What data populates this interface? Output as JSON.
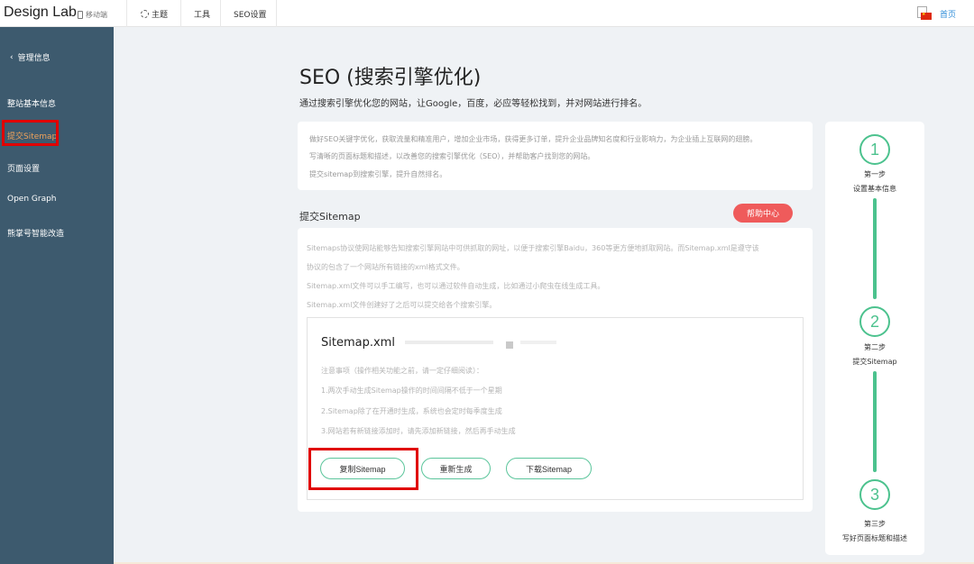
{
  "header": {
    "logo": "Design Lab",
    "mobile_label": "移动端",
    "nav": [
      {
        "label": "主题",
        "icon": "theme-icon"
      },
      {
        "label": "工具"
      },
      {
        "label": "SEO设置"
      }
    ],
    "home_label": "首页",
    "flag_icon": "cn-flag-icon"
  },
  "sidebar": {
    "back_label": "管理信息",
    "items": [
      {
        "label": "整站基本信息",
        "active": false
      },
      {
        "label": "提交Sitemap",
        "active": true
      },
      {
        "label": "页面设置",
        "active": false
      },
      {
        "label": "Open Graph",
        "active": false
      },
      {
        "label": "熊掌号智能改造",
        "active": false
      }
    ]
  },
  "page": {
    "title": "SEO (搜索引擎优化)",
    "subtitle": "通过搜索引擎优化您的网站，让Google，百度，必应等轻松找到，并对网站进行排名。"
  },
  "intro": [
    "做好SEO关键字优化，获取流量和精准用户，增加企业市场，获得更多订单，提升企业品牌知名度和行业影响力，为企业插上互联网的翅膀。",
    "写清晰的页面标题和描述，以改善您的搜索引擎优化（SEO），并帮助客户找到您的网站。",
    "提交sitemap到搜索引擎，提升自然排名。"
  ],
  "sitemap": {
    "section_title": "提交Sitemap",
    "help_label": "帮助中心",
    "desc": [
      "Sitemaps协议使网站能够告知搜索引擎网站中可供抓取的网址，以便于搜索引擎Baidu，360等更方便地抓取网站。而Sitemap.xml是遵守该",
      "协议的包含了一个网站所有链接的xml格式文件。",
      "Sitemap.xml文件可以手工编写，也可以通过软件自动生成，比如通过小爬虫在线生成工具。",
      "Sitemap.xml文件创建好了之后可以提交给各个搜索引擎。"
    ],
    "box_title": "Sitemap.xml",
    "notes": [
      "注意事项（操作相关功能之前，请一定仔细阅读）：",
      "1.两次手动生成Sitemap操作的时间间隔不低于一个星期",
      "2.Sitemap除了在开通时生成，系统也会定时每季度生成",
      "3.网站若有新链接添加时，请先添加新链接，然后再手动生成"
    ],
    "buttons": {
      "copy": "复制Sitemap",
      "regenerate": "重新生成",
      "download": "下载Sitemap"
    }
  },
  "steps": [
    {
      "number": "1",
      "label": "第一步",
      "name": "设置基本信息"
    },
    {
      "number": "2",
      "label": "第二步",
      "name": "提交Sitemap"
    },
    {
      "number": "3",
      "label": "第三步",
      "name": "写好页面标题和描述"
    }
  ],
  "colors": {
    "sidebar_bg": "#3d5a6e",
    "accent_green": "#4cc28e",
    "help_red": "#ef5b5b",
    "highlight_red": "#e00000",
    "link_blue": "#2f8dd8"
  }
}
